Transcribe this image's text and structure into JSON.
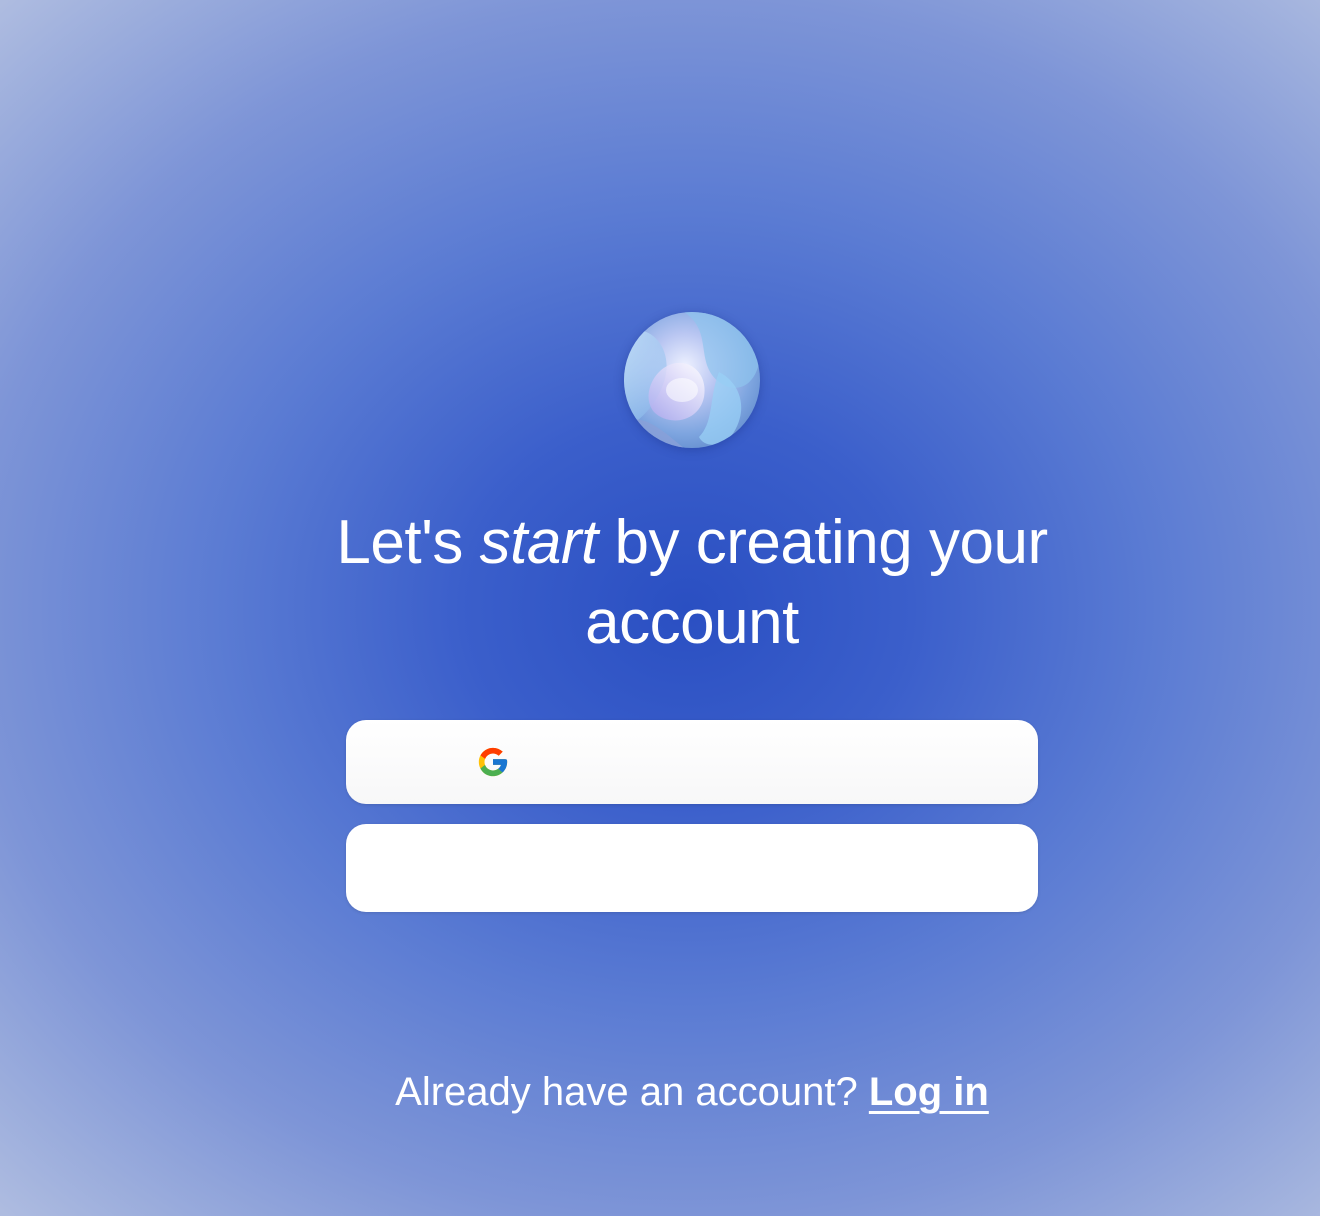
{
  "headline": {
    "before": "Let's",
    "emphasis": "start",
    "after": "by creating your account"
  },
  "buttons": {
    "google_icon": "google-g-icon",
    "second_label": ""
  },
  "footer": {
    "prompt": "Already have an account?",
    "login_link": "Log in"
  },
  "colors": {
    "background_center": "#2a4fc2",
    "background_edge": "#b6c2e2",
    "button_bg": "#ffffff",
    "text": "#ffffff"
  }
}
